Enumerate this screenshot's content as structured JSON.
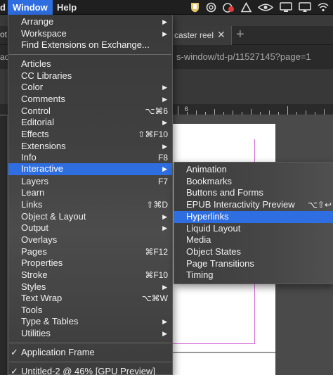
{
  "menubar": {
    "partial_label": "d",
    "window_label": "Window",
    "help_label": "Help",
    "status_icons": [
      "shield-icon",
      "spiral-icon",
      "record-badge-icon",
      "triangle-icon",
      "eye-icon",
      "display-icon",
      "cast-icon",
      "wifi-icon"
    ]
  },
  "browser": {
    "left_tab_text": "ot",
    "right_tab_text": "caster reel",
    "new_tab_label": "+",
    "close_label": "✕",
    "url_left": "ac",
    "url_right": "s-window/td-p/11527145?page=1"
  },
  "ruler": {
    "label": "6"
  },
  "window_menu": {
    "items": [
      {
        "label": "Arrange",
        "submenu": true
      },
      {
        "label": "Workspace",
        "submenu": true
      },
      {
        "label": "Find Extensions on Exchange..."
      },
      {
        "label": "Articles"
      },
      {
        "label": "CC Libraries"
      },
      {
        "label": "Color",
        "submenu": true
      },
      {
        "label": "Comments",
        "submenu": true
      },
      {
        "label": "Control",
        "shortcut": "⌥⌘6"
      },
      {
        "label": "Editorial",
        "submenu": true
      },
      {
        "label": "Effects",
        "shortcut": "⇧⌘F10"
      },
      {
        "label": "Extensions",
        "submenu": true
      },
      {
        "label": "Info",
        "shortcut": "F8"
      },
      {
        "label": "Interactive",
        "submenu": true,
        "active": true
      },
      {
        "label": "Layers",
        "shortcut": "F7"
      },
      {
        "label": "Learn"
      },
      {
        "label": "Links",
        "shortcut": "⇧⌘D"
      },
      {
        "label": "Object & Layout",
        "submenu": true
      },
      {
        "label": "Output",
        "submenu": true
      },
      {
        "label": "Overlays"
      },
      {
        "label": "Pages",
        "shortcut": "⌘F12"
      },
      {
        "label": "Properties"
      },
      {
        "label": "Stroke",
        "shortcut": "⌘F10"
      },
      {
        "label": "Styles",
        "submenu": true
      },
      {
        "label": "Text Wrap",
        "shortcut": "⌥⌘W"
      },
      {
        "label": "Tools"
      },
      {
        "label": "Type & Tables",
        "submenu": true
      },
      {
        "label": "Utilities",
        "submenu": true
      },
      {
        "label": "Application Frame",
        "checked": true
      },
      {
        "label": "Untitled-2 @ 46% [GPU Preview]",
        "checked": true
      }
    ],
    "check_glyph": "✓",
    "arrow_glyph": "▶"
  },
  "interactive_submenu": {
    "items": [
      {
        "label": "Animation"
      },
      {
        "label": "Bookmarks"
      },
      {
        "label": "Buttons and Forms"
      },
      {
        "label": "EPUB Interactivity Preview",
        "shortcut": "⌥⇧↩"
      },
      {
        "label": "Hyperlinks",
        "active": true
      },
      {
        "label": "Liquid Layout"
      },
      {
        "label": "Media"
      },
      {
        "label": "Object States"
      },
      {
        "label": "Page Transitions"
      },
      {
        "label": "Timing"
      }
    ]
  },
  "colors": {
    "highlight": "#2f6ee0",
    "menu_bg": "#404040",
    "margin_guide": "#d86ad8"
  }
}
